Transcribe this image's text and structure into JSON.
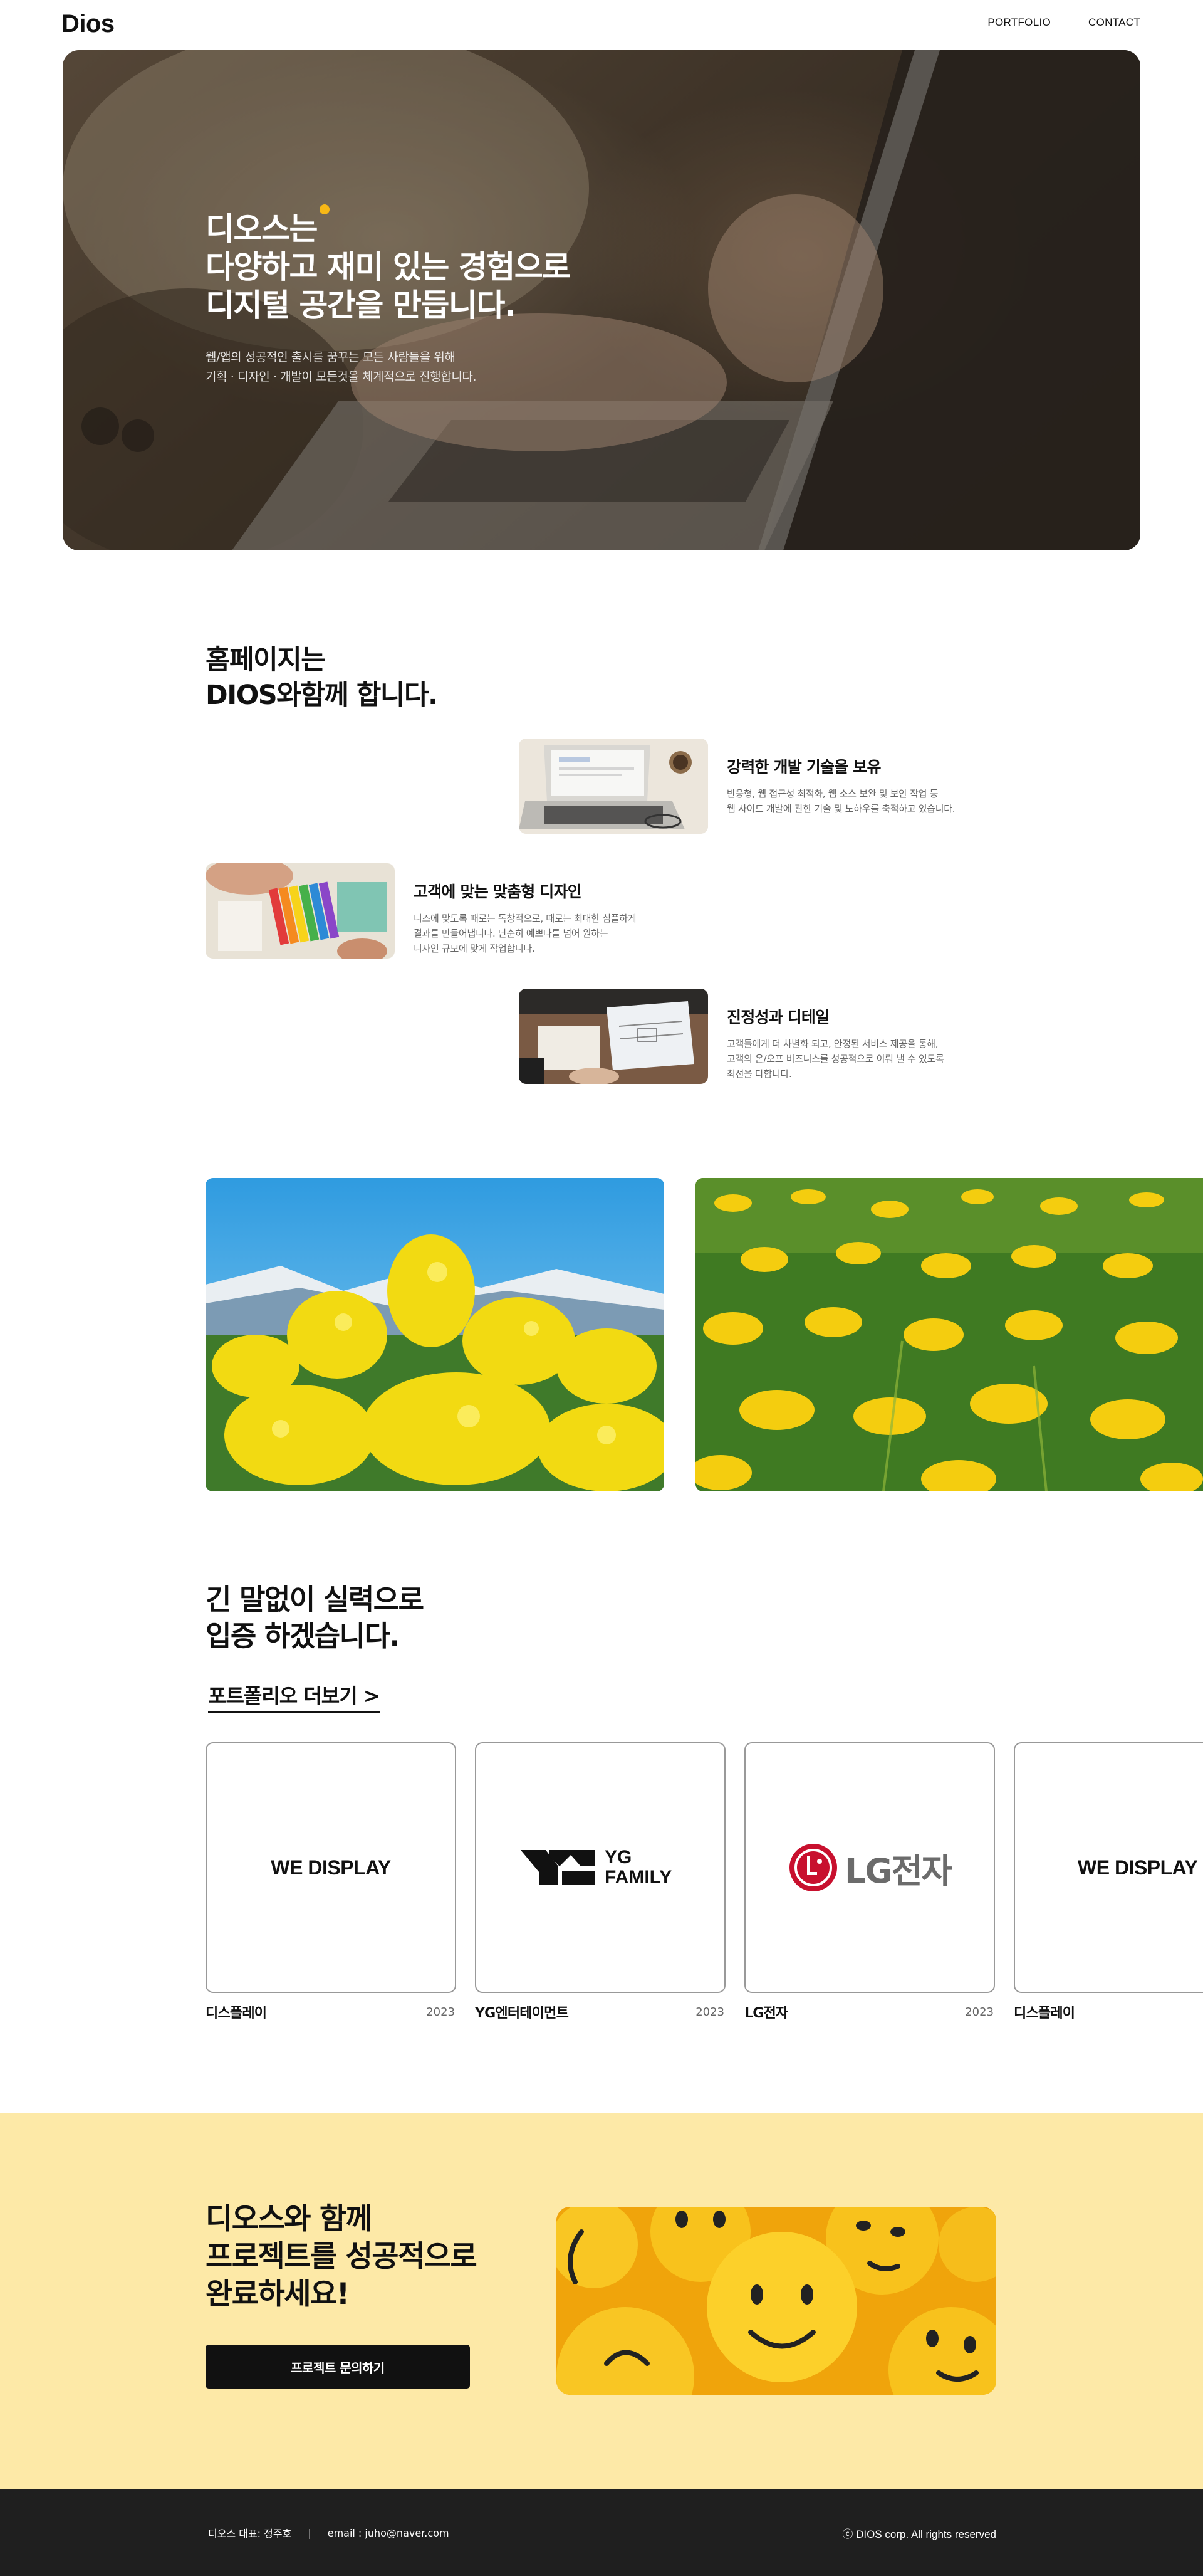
{
  "header": {
    "logo": "Dios",
    "nav": [
      "PORTFOLIO",
      "CONTACT"
    ]
  },
  "hero": {
    "title_lines": [
      "디오스는",
      "다양하고 재미 있는 경험으로",
      "디지털 공간을 만듭니다."
    ],
    "subtitle_lines": [
      "웹/앱의 성공적인 출시를 꿈꾸는 모든 사람들을 위해",
      "기획 · 디자인 · 개발이 모든것을 체계적으로 진행합니다."
    ],
    "accent_color": "#f6b716"
  },
  "about": {
    "title_lines": [
      "홈페이지는",
      "DIOS와함께 합니다."
    ],
    "features": [
      {
        "title": "강력한 개발 기술을 보유",
        "desc_lines": [
          "반응형, 웹 접근성 최적화, 웹 소스 보완 및 보안 작업 등",
          "웹 사이트 개발에 관한 기술 및 노하우를 축적하고 있습니다."
        ]
      },
      {
        "title": "고객에 맞는 맞춤형 디자인",
        "desc_lines": [
          "니즈에 맞도록 때로는 독창적으로, 때로는 최대한 심플하게",
          "결과를 만들어냅니다. 단순히 예쁘다를 넘어 원하는",
          "디자인 규모에 맞게 작업합니다."
        ]
      },
      {
        "title": "진정성과 디테일",
        "desc_lines": [
          "고객들에게 더 차별화 되고, 안정된 서비스 제공을 통해,",
          "고객의 온/오프 비즈니스를 성공적으로 이뤄 낼 수 있도록",
          "최선을 다합니다."
        ]
      }
    ]
  },
  "portfolio": {
    "title_lines": [
      "긴 말없이 실력으로",
      "입증 하겠습니다."
    ],
    "more_link": "포트폴리오 더보기 >",
    "cards": [
      {
        "logo_text": "WE DISPLAY",
        "name": "디스플레이",
        "year": "2023"
      },
      {
        "logo_text": "YG FAMILY",
        "name": "YG엔터테이먼트",
        "year": "2023"
      },
      {
        "logo_text": "LG전자",
        "name": "LG전자",
        "year": "2023"
      },
      {
        "logo_text": "WE DISPLAY",
        "name": "디스플레이",
        "year": ""
      }
    ]
  },
  "cta": {
    "title_lines": [
      "디오스와 함께",
      "프로젝트를 성공적으로",
      "완료하세요!"
    ],
    "button": "프로젝트 문의하기"
  },
  "footer": {
    "ceo": "디오스 대표: 정주호",
    "separator": "|",
    "email": "email : juho@naver.com",
    "copyright": "ⓒ DIOS corp. All rights reserved"
  },
  "colors": {
    "cta_bg": "#fde9a7",
    "footer_bg": "#1f1f1f",
    "lg_red": "#c8102e"
  }
}
